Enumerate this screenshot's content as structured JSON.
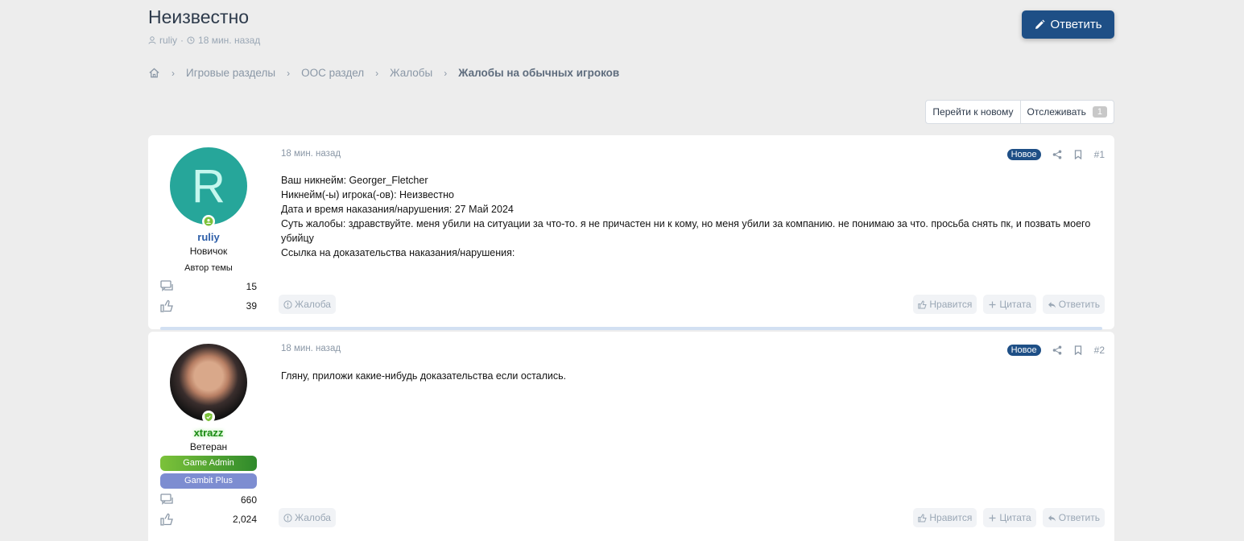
{
  "thread": {
    "title": "Неизвестно",
    "author": "ruliy",
    "separator": "·",
    "time": "18 мин. назад",
    "reply_button": "Ответить"
  },
  "breadcrumb": {
    "home_icon": "home-icon",
    "items": [
      "Игровые разделы",
      "ООС раздел",
      "Жалобы",
      "Жалобы на обычных игроков"
    ]
  },
  "tools": {
    "go_to_new": "Перейти к новому",
    "watch": "Отслеживать",
    "watch_count": "1"
  },
  "posts": [
    {
      "avatar_letter": "R",
      "username": "ruliy",
      "user_title": "Новичок",
      "role": "Автор темы",
      "banners": [],
      "messages": "15",
      "reactions": "39",
      "date": "18 мин. назад",
      "badge": "Новое",
      "number": "#1",
      "body": [
        "Ваш никнейм: Georger_Fletcher",
        "Никнейм(-ы) игрока(-ов): Неизвестно",
        "Дата и время наказания/нарушения: 27 Май 2024",
        "Суть жалобы: здравствуйте. меня убили на ситуации за что-то. я не причастен ни к кому, но меня убили за компанию. не понимаю за что. просьба снять пк, и позвать моего убийцу",
        "Ссылка на доказательства наказания/нарушения:"
      ],
      "report": "Жалоба",
      "like": "Нравится",
      "quote": "Цитата",
      "reply": "Ответить"
    },
    {
      "avatar_letter": "",
      "username": "xtrazz",
      "user_title": "Ветеран",
      "role": "",
      "banners": [
        "Game Admin",
        "Gambit Plus"
      ],
      "messages": "660",
      "reactions": "2,024",
      "date": "18 мин. назад",
      "badge": "Новое",
      "number": "#2",
      "body": [
        "Гляну, приложи какие-нибудь доказательства если остались."
      ],
      "report": "Жалоба",
      "like": "Нравится",
      "quote": "Цитата",
      "reply": "Ответить"
    }
  ],
  "colors": {
    "accent": "#1e4f86",
    "avatar_bg": "#26a69a",
    "admin_name": "#1c8a16",
    "divider": "#d2e0f2"
  }
}
